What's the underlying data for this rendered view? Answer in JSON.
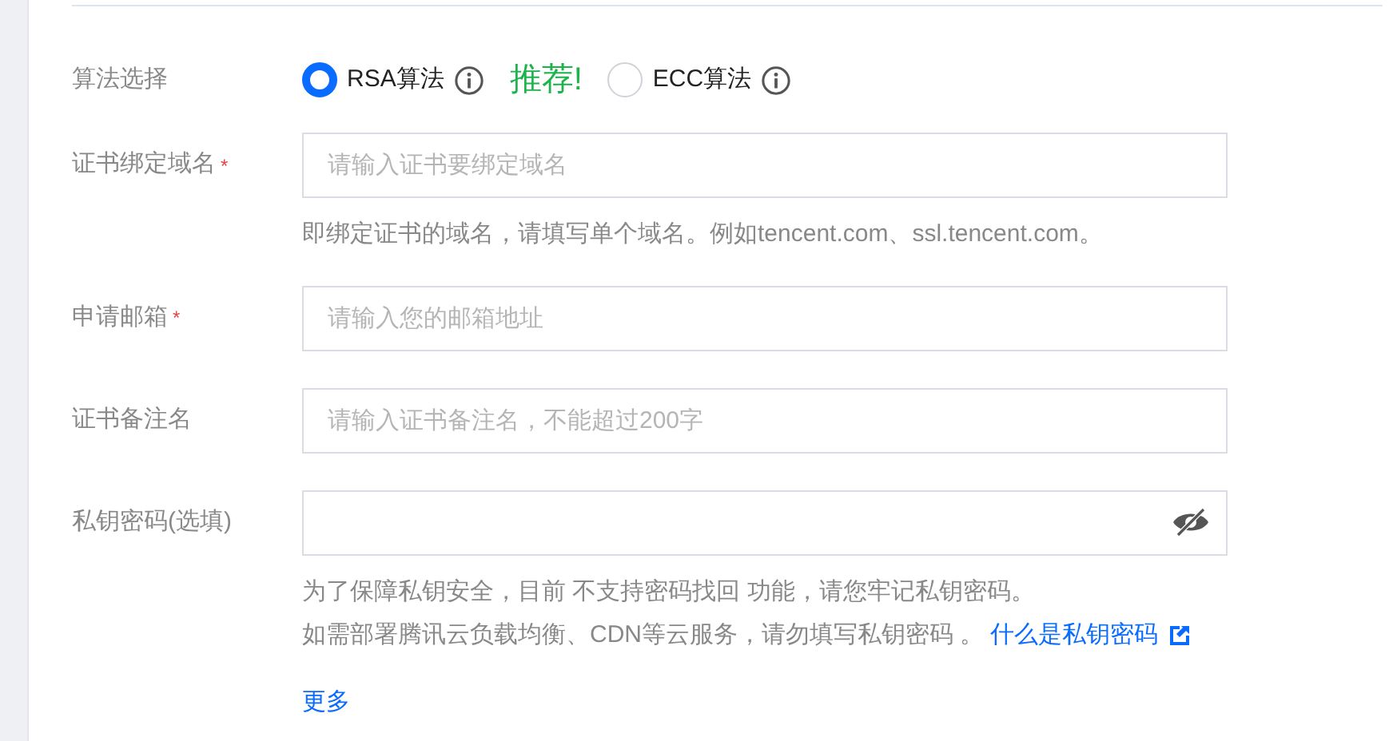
{
  "algorithm": {
    "label": "算法选择",
    "options": [
      {
        "label": "RSA算法",
        "selected": true
      },
      {
        "label": "ECC算法",
        "selected": false
      }
    ],
    "recommend": "推荐!"
  },
  "fields": [
    {
      "label": "证书绑定域名",
      "required_mark": "*",
      "placeholder": "请输入证书要绑定域名",
      "hint": "即绑定证书的域名，请填写单个域名。例如tencent.com、ssl.tencent.com。",
      "kind": "text"
    },
    {
      "label": "申请邮箱",
      "required_mark": "*",
      "placeholder": "请输入您的邮箱地址",
      "kind": "text"
    },
    {
      "label": "证书备注名",
      "placeholder": "请输入证书备注名，不能超过200字",
      "kind": "text"
    },
    {
      "label": "私钥密码(选填)",
      "kind": "password"
    }
  ],
  "password_notes": [
    "为了保障私钥安全，目前 不支持密码找回 功能，请您牢记私钥密码。",
    "如需部署腾讯云负载均衡、CDN等云服务，请勿填写私钥密码 。"
  ],
  "help_link": "什么是私钥密码",
  "more_link": "更多"
}
